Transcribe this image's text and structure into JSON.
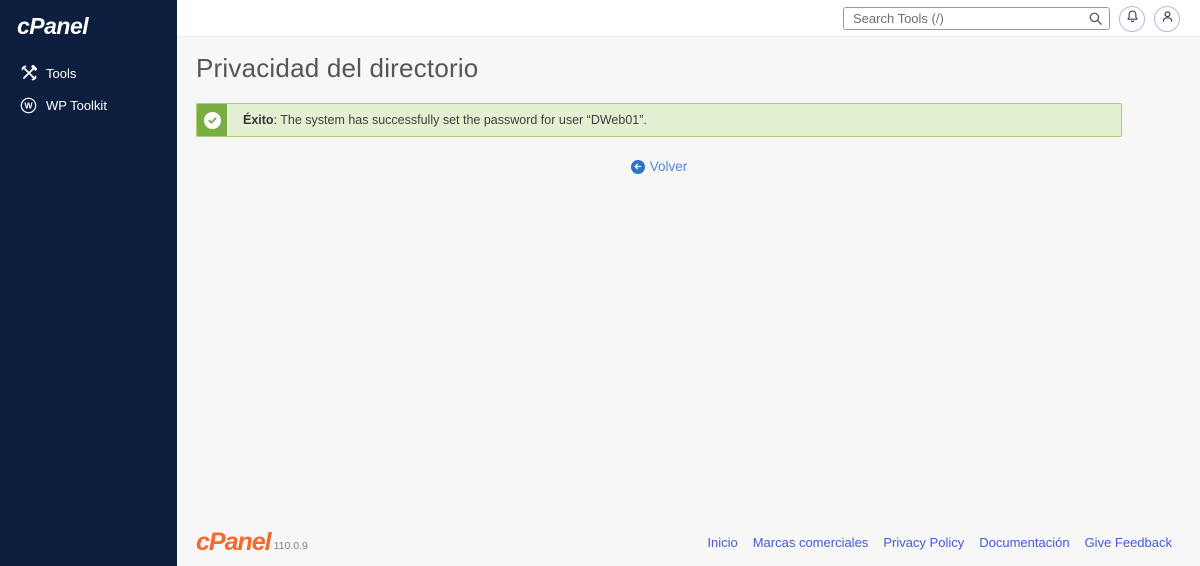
{
  "sidebar": {
    "logo": "cPanel",
    "items": [
      {
        "label": "Tools",
        "icon": "tools-icon"
      },
      {
        "label": "WP Toolkit",
        "icon": "wordpress-icon"
      }
    ]
  },
  "topbar": {
    "search_placeholder": "Search Tools (/)"
  },
  "main": {
    "title": "Privacidad del directorio",
    "alert": {
      "type": "success",
      "label": "Éxito",
      "message": ": The system has successfully set the password for user “DWeb01”."
    },
    "back_link_label": "Volver"
  },
  "footer": {
    "logo": "cPanel",
    "version": "110.0.9",
    "links": [
      {
        "label": "Inicio"
      },
      {
        "label": "Marcas comerciales"
      },
      {
        "label": "Privacy Policy"
      },
      {
        "label": "Documentación"
      },
      {
        "label": "Give Feedback"
      }
    ]
  },
  "colors": {
    "sidebar_bg": "#0e1e3e",
    "accent_orange": "#f4692e",
    "success_green": "#7aad43",
    "success_bg": "#e3f0d1",
    "footer_link_blue": "#4a58d5",
    "back_link_blue": "#4e86d1"
  }
}
